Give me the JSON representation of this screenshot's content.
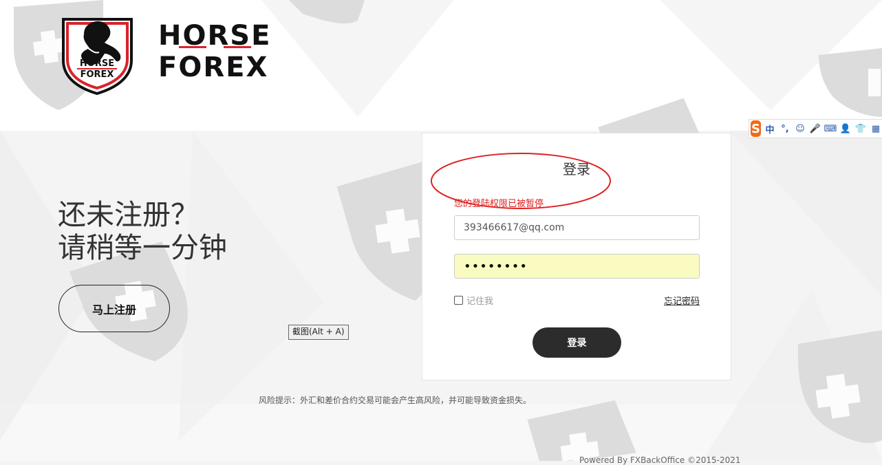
{
  "brand": {
    "line1": "HORSE",
    "line2": "FOREX",
    "emblem_line1": "HORSE",
    "emblem_line2": "FOREX",
    "accent_color": "#d9222a"
  },
  "promo": {
    "line1": "还未注册？",
    "line2": "请稍等一分钟",
    "register_label": "马上注册"
  },
  "screenshot_tip": "截图(Alt + A)",
  "login": {
    "title": "登录",
    "error": "您的登陆权限已被暂停",
    "email_value": "393466617@qq.com",
    "password_value": "••••••••",
    "remember_label": "记住我",
    "forgot_label": "忘记密码",
    "submit_label": "登录",
    "error_color": "#e02020"
  },
  "footer": {
    "risk_note": "风险提示：外汇和差价合约交易可能会产生高风险，并可能导致资金损失。",
    "powered": "Powered By FXBackOffice ©2015-2021"
  },
  "ime": {
    "logo": "S",
    "items": [
      "中",
      "°,",
      "☺",
      "🎤",
      "⌨",
      "👤",
      "👕",
      "▦"
    ]
  }
}
